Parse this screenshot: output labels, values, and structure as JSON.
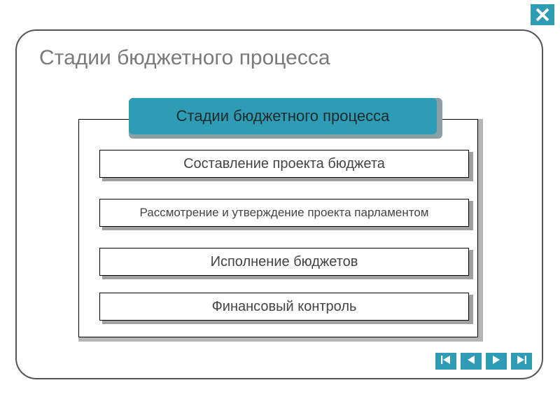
{
  "page_title": "Стадии бюджетного процесса",
  "diagram": {
    "header": "Стадии бюджетного процесса",
    "stages": [
      "Составление проекта бюджета",
      "Рассмотрение и утверждение проекта парламентом",
      "Исполнение бюджетов",
      "Финансовый контроль"
    ]
  },
  "colors": {
    "accent": "#2d9cb4"
  }
}
